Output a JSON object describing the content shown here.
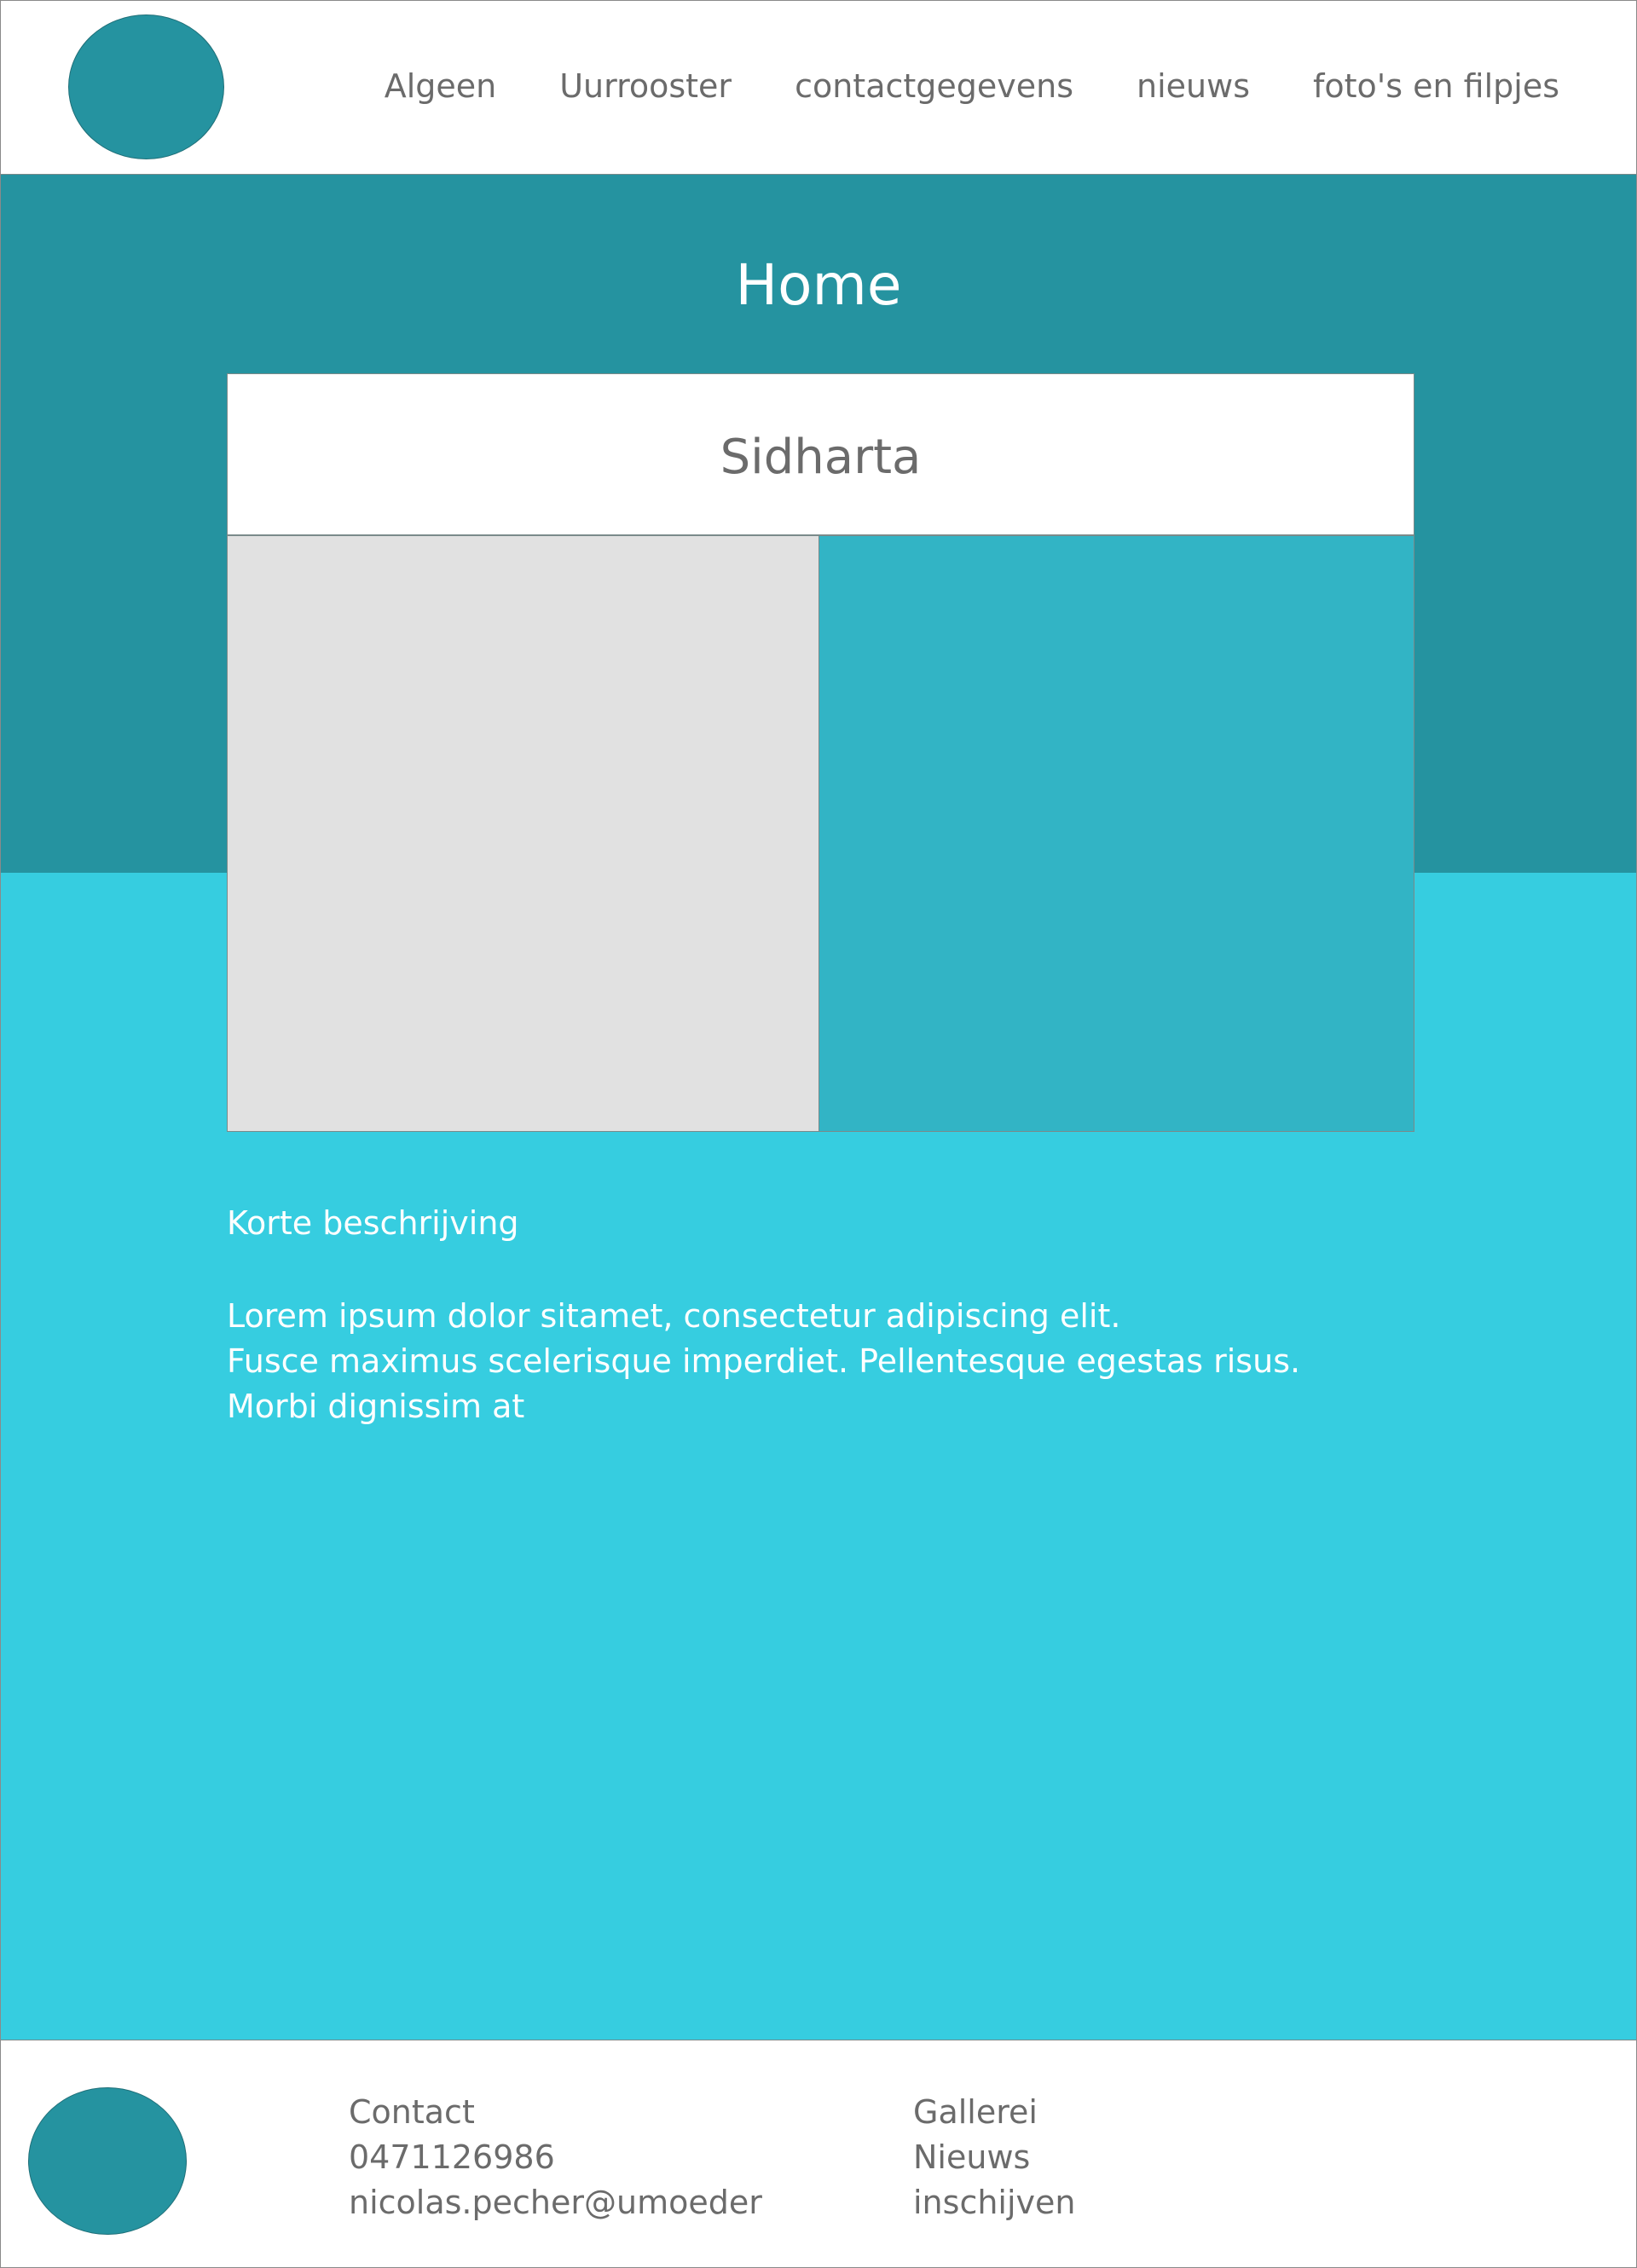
{
  "header": {
    "logo": "logo-circle",
    "nav": [
      "Algeen",
      "Uurrooster",
      "contactgegevens",
      "nieuws",
      "foto's en filpjes"
    ]
  },
  "hero": {
    "title": "Home"
  },
  "card": {
    "title": "Sidharta"
  },
  "description": {
    "heading": "Korte beschrijving",
    "lines": [
      "Lorem ipsum dolor sitamet, consectetur adipiscing elit.",
      "Fusce maximus scelerisque imperdiet. Pellentesque egestas risus.",
      "Morbi dignissim at"
    ]
  },
  "footer": {
    "contact": {
      "title": "Contact",
      "phone": "0471126986",
      "email": "nicolas.pecher@umoeder"
    },
    "links": [
      "Gallerei",
      "Nieuws",
      "inschijven"
    ]
  },
  "colors": {
    "primary": "#2593a0",
    "accent": "#36cde0",
    "image_right": "#32b4c5",
    "image_left": "#e1e1e1"
  }
}
